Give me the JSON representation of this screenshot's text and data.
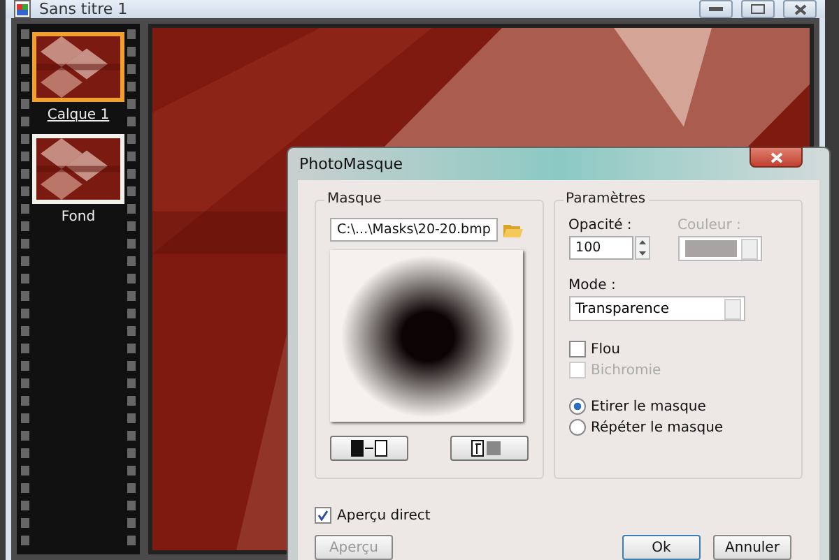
{
  "window": {
    "title": "Sans titre 1"
  },
  "layers": [
    {
      "name": "Calque 1",
      "selected": true
    },
    {
      "name": "Fond",
      "selected": false
    }
  ],
  "dialog": {
    "title": "PhotoMasque",
    "mask_group": {
      "title": "Masque",
      "path": "C:\\...\\Masks\\20-20.bmp"
    },
    "params_group": {
      "title": "Paramètres",
      "opacity_label": "Opacité :",
      "opacity": "100",
      "color_label": "Couleur :",
      "color_disabled": true,
      "mode_label": "Mode :",
      "mode": "Transparence",
      "checks": [
        {
          "label": "Flou",
          "checked": false,
          "disabled": false
        },
        {
          "label": "Bichromie",
          "checked": false,
          "disabled": true
        }
      ],
      "radios": [
        {
          "label": "Etirer le masque",
          "selected": true
        },
        {
          "label": "Répéter le masque",
          "selected": false
        }
      ]
    },
    "live_preview": {
      "label": "Aperçu direct",
      "checked": true
    },
    "buttons": [
      {
        "label": "Aperçu",
        "disabled": true,
        "default": false
      },
      {
        "label": "Ok",
        "disabled": false,
        "default": true
      },
      {
        "label": "Annuler",
        "disabled": false,
        "default": false
      }
    ]
  }
}
